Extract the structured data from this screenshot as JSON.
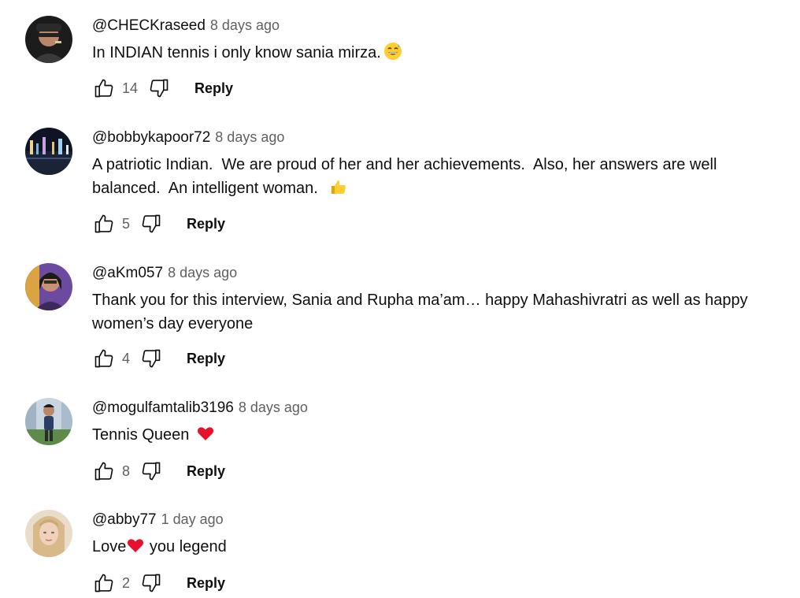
{
  "comments": [
    {
      "author": "@CHECKraseed",
      "time": "8 days ago",
      "text": "In INDIAN tennis i only know sania mirza.",
      "emoji": "grinning-sweat-emoji",
      "likes": "14",
      "reply_label": "Reply"
    },
    {
      "author": "@bobbykapoor72",
      "time": "8 days ago",
      "text": "A patriotic Indian.  We are proud of her and her achievements.  Also, her answers are well balanced.  An intelligent woman.  ",
      "emoji": "thumbs-up-emoji",
      "likes": "5",
      "reply_label": "Reply"
    },
    {
      "author": "@aKm057",
      "time": "8 days ago",
      "text": "Thank you for this interview, Sania and Rupha ma’am… happy Mahashivratri as well as happy women’s day everyone",
      "likes": "4",
      "reply_label": "Reply"
    },
    {
      "author": "@mogulfamtalib3196",
      "time": "8 days ago",
      "text": "Tennis Queen ",
      "emoji": "red-heart-emoji",
      "likes": "8",
      "reply_label": "Reply"
    },
    {
      "author": "@abby77",
      "time": "1 day ago",
      "text_before": "Love",
      "emoji": "red-heart-emoji",
      "text_after": " you legend",
      "likes": "2",
      "reply_label": "Reply"
    }
  ],
  "colors": {
    "text": "#0f0f0f",
    "secondary": "#606060",
    "heart": "#e8112d",
    "emoji_yellow": "#ffcc33"
  }
}
